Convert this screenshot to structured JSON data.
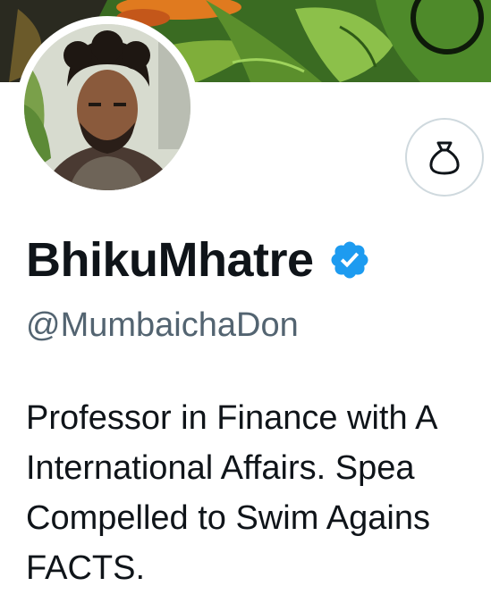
{
  "profile": {
    "display_name": "BhikuMhatre",
    "handle": "@MumbaichaDon",
    "bio_lines": [
      "Professor in Finance with A",
      "International Affairs. Spea",
      "Compelled to Swim Agains",
      "FACTS."
    ]
  },
  "icons": {
    "verified": "verified-badge-icon",
    "tip": "money-bag-icon"
  },
  "colors": {
    "verified_blue": "#1d9bf0",
    "text_primary": "#0f1419",
    "text_secondary": "#536471",
    "button_border": "#cfd9de"
  }
}
